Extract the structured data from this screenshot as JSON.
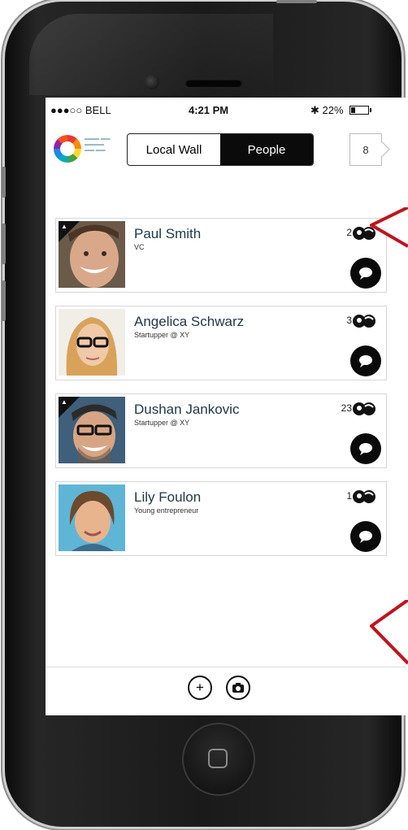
{
  "status_bar": {
    "carrier": "●●●○○ BELL",
    "time": "4:21 PM",
    "battery": "22%"
  },
  "header": {
    "tabs": [
      {
        "label": "Local Wall",
        "active": false
      },
      {
        "label": "People",
        "active": true
      }
    ],
    "notification_count": "8"
  },
  "people": [
    {
      "name": "Paul Smith",
      "role": "VC",
      "count": "2",
      "admin_badge": true
    },
    {
      "name": "Angelica Schwarz",
      "role": "Startupper @ XY",
      "count": "3",
      "admin_badge": false
    },
    {
      "name": "Dushan Jankovic",
      "role": "Startupper @ XY",
      "count": "23",
      "admin_badge": true
    },
    {
      "name": "Lily Foulon",
      "role": "Young entrepreneur",
      "count": "1",
      "admin_badge": false
    }
  ],
  "bottom_bar": {
    "add_label": "+"
  },
  "colors": {
    "accent": "#0b0b0b",
    "name_text": "#22384a",
    "annotation_arrow": "#c0141b"
  }
}
